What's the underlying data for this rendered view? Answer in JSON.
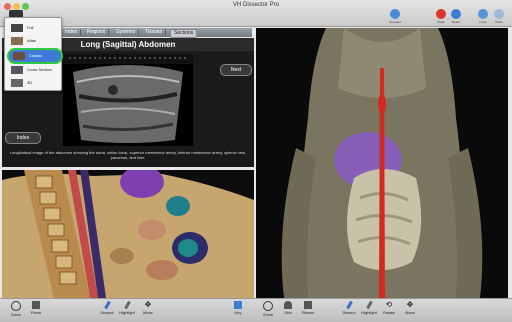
{
  "app_title": "VH Dissector Pro",
  "toolbar": {
    "clear": "Clear",
    "reset": "Reset",
    "undo": "Undo",
    "redo": "Redo",
    "grouped": "Grouped"
  },
  "nav": {
    "tabs": [
      "Index",
      "Regions",
      "Systems",
      "Tissues",
      "Sections"
    ],
    "active": "Sections"
  },
  "view_menu": {
    "items": [
      "Full",
      "Atlas",
      "Classic",
      "Cross Section",
      "3D"
    ],
    "selected": "Classic"
  },
  "info_panel": {
    "title": "Long (Sagittal) Abdomen",
    "next": "Next",
    "index": "Index",
    "caption": "Longitudinal image of the abdomen showing the aorta, celiac trunk, superior mesenteric artery, inferior mesenteric artery, splenic vein, pancreas, and liver."
  },
  "bottom_left": {
    "zoom": "Zoom",
    "plane": "Plane",
    "dissect": "Dissect",
    "highlight": "Highlight",
    "move": "Move",
    "key": "Key"
  },
  "bottom_right": {
    "zoom": "Zoom",
    "skin": "Skin",
    "planes": "Planes",
    "dissect": "Dissect",
    "highlight": "Highlight",
    "rotate": "Rotate",
    "move": "Move"
  },
  "colors": {
    "highlight_ring": "#2ecc40",
    "aorta": "#d4291f",
    "organ_purple": "#7e4fc7"
  }
}
